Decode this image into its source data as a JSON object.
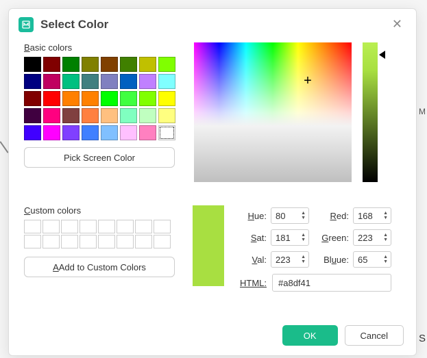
{
  "title": "Select Color",
  "labels": {
    "basic": "asic colors",
    "custom": "ustom colors",
    "pick_screen": "Pick Screen Color",
    "add_custom": "Add to Custom Colors",
    "ok": "OK",
    "cancel": "Cancel"
  },
  "fields": {
    "hue": {
      "label": "ue:",
      "value": "80"
    },
    "sat": {
      "label": "at:",
      "value": "181"
    },
    "val": {
      "label": "al:",
      "value": "223"
    },
    "red": {
      "label": "ed:",
      "value": "168"
    },
    "green": {
      "label": "reen:",
      "value": "223"
    },
    "blue": {
      "label": "ue:",
      "value": "65"
    },
    "html": {
      "label": "HTML:",
      "value": "#a8df41"
    }
  },
  "selected_color": "#a8df41",
  "basic_colors": [
    "#000000",
    "#800000",
    "#008000",
    "#808000",
    "#804000",
    "#408000",
    "#c0c000",
    "#80ff00",
    "#000080",
    "#c00060",
    "#00c080",
    "#408080",
    "#8080c0",
    "#0060c0",
    "#c080ff",
    "#80ffff",
    "#800000",
    "#ff0000",
    "#ff8000",
    "#ff8000",
    "#00ff00",
    "#40ff40",
    "#80ff00",
    "#ffff00",
    "#400040",
    "#ff0080",
    "#804040",
    "#ff8040",
    "#ffc080",
    "#80ffc0",
    "#c0ffc0",
    "#ffff80",
    "#4000ff",
    "#ff00ff",
    "#8040ff",
    "#4080ff",
    "#80c0ff",
    "#ffc0ff",
    "#ff80c0",
    "#ffffff"
  ]
}
